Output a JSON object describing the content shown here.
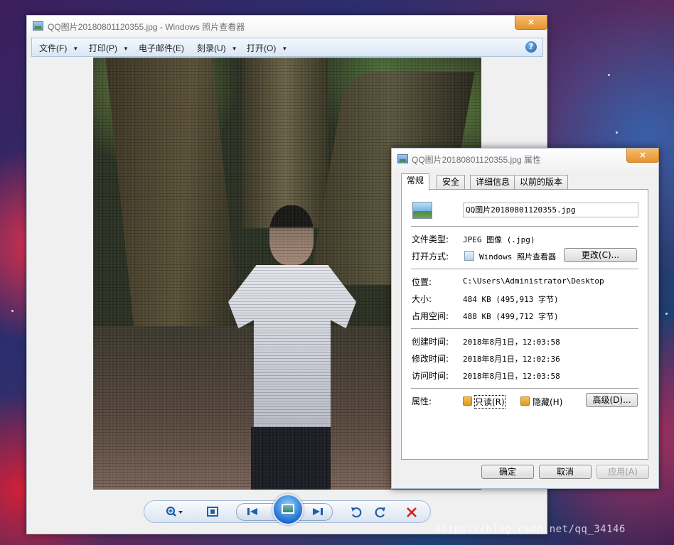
{
  "viewer": {
    "title": "QQ图片20180801120355.jpg - Windows 照片查看器",
    "close_label": "×",
    "menu": [
      {
        "label": "文件(F)"
      },
      {
        "label": "打印(P)"
      },
      {
        "label": "电子邮件(E)"
      },
      {
        "label": "刻录(U)"
      },
      {
        "label": "打开(O)"
      }
    ],
    "help_label": "?",
    "toolbar": {
      "zoom_icon": "magnifier-plus-icon",
      "fit_icon": "fit-window-icon",
      "previous_icon": "skip-previous-icon",
      "slideshow_icon": "slideshow-icon",
      "next_icon": "skip-next-icon",
      "rotate_ccw_icon": "rotate-counterclockwise-icon",
      "rotate_cw_icon": "rotate-clockwise-icon",
      "delete_icon": "delete-x-icon"
    }
  },
  "properties": {
    "title": "QQ图片20180801120355.jpg 属性",
    "close_label": "×",
    "tabs": [
      {
        "label": "常规",
        "active": true
      },
      {
        "label": "安全"
      },
      {
        "label": "详细信息"
      },
      {
        "label": "以前的版本"
      }
    ],
    "filename": "QQ图片20180801120355.jpg",
    "file_type_label": "文件类型:",
    "file_type_value": "JPEG 图像 (.jpg)",
    "opens_with_label": "打开方式:",
    "opens_with_value": "Windows 照片查看器",
    "change_button": "更改(C)...",
    "location_label": "位置:",
    "location_value": "C:\\Users\\Administrator\\Desktop",
    "size_label": "大小:",
    "size_value": "484 KB (495,913 字节)",
    "size_on_disk_label": "占用空间:",
    "size_on_disk_value": "488 KB (499,712 字节)",
    "created_label": "创建时间:",
    "created_value": "2018年8月1日，12:03:58",
    "modified_label": "修改时间:",
    "modified_value": "2018年8月1日，12:02:36",
    "accessed_label": "访问时间:",
    "accessed_value": "2018年8月1日，12:03:58",
    "attributes_label": "属性:",
    "readonly_label": "只读(R)",
    "hidden_label": "隐藏(H)",
    "advanced_button": "高级(D)...",
    "ok_button": "确定",
    "cancel_button": "取消",
    "apply_button": "应用(A)"
  },
  "watermark": "https://blog.csdn.net/qq_34146"
}
